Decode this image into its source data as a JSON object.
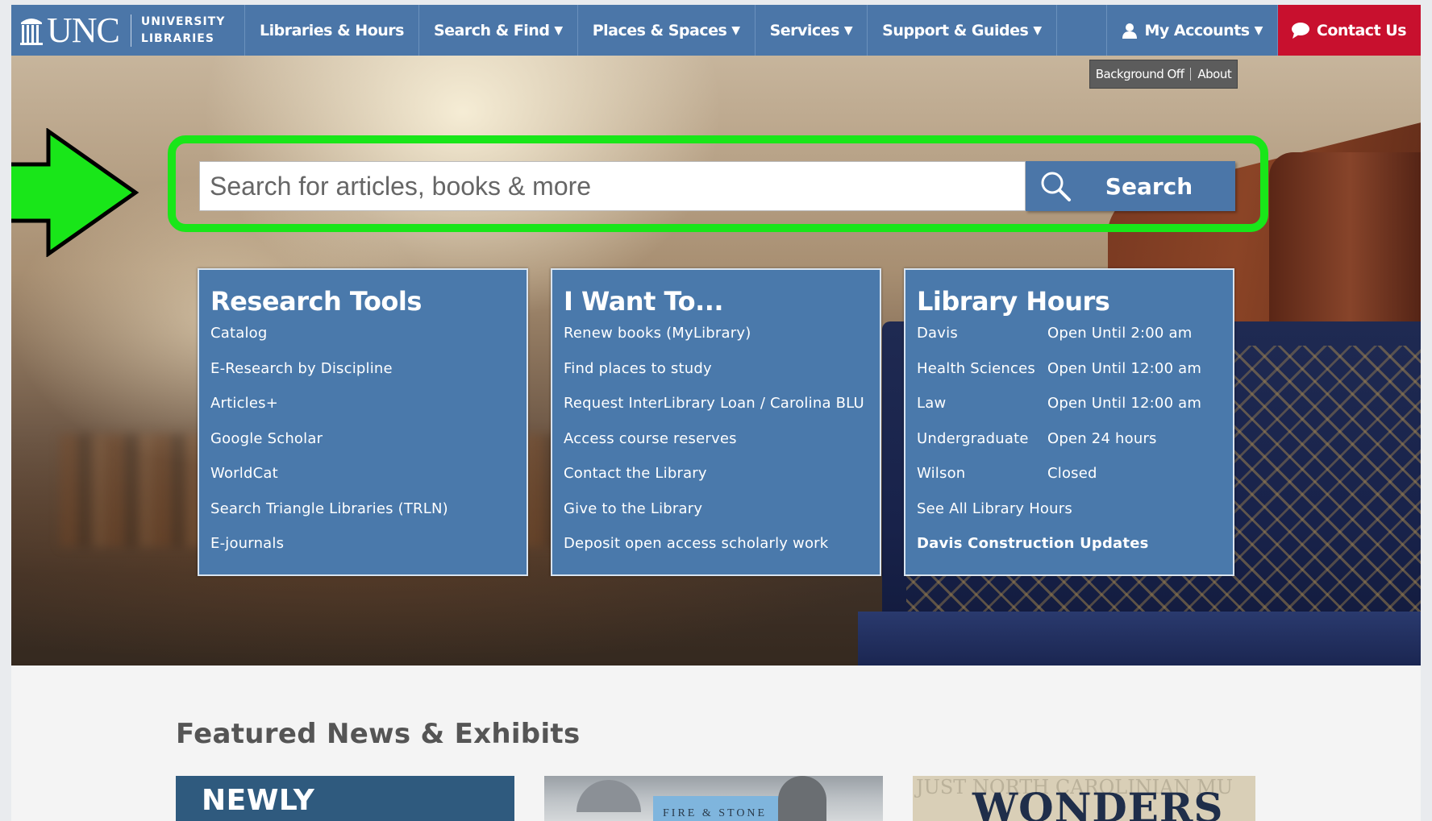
{
  "nav": {
    "logo_main": "UNC",
    "logo_line1": "UNIVERSITY",
    "logo_line2": "LIBRARIES",
    "items": [
      {
        "label": "Libraries & Hours",
        "caret": ""
      },
      {
        "label": "Search & Find",
        "caret": "▼"
      },
      {
        "label": "Places & Spaces",
        "caret": "▼"
      },
      {
        "label": "Services",
        "caret": "▼"
      },
      {
        "label": "Support & Guides",
        "caret": "▼"
      }
    ],
    "accounts": {
      "label": "My Accounts",
      "caret": "▼",
      "icon": "person-icon"
    },
    "contact": {
      "label": "Contact Us",
      "icon": "chat-bubble-icon"
    },
    "colors": {
      "nav_bg": "#4b76a8",
      "contact_bg": "#c8102e"
    }
  },
  "background_toggle": {
    "off_label": "Background Off",
    "about_label": "About"
  },
  "search": {
    "placeholder": "Search for articles, books & more",
    "button_label": "Search",
    "icon": "search-icon",
    "highlight_color": "#19e619"
  },
  "panels": {
    "research": {
      "title": "Research Tools",
      "links": [
        "Catalog",
        "E-Research by Discipline",
        "Articles+",
        "Google Scholar",
        "WorldCat",
        "Search Triangle Libraries (TRLN)",
        "E-journals"
      ]
    },
    "want": {
      "title": "I Want To...",
      "links": [
        "Renew books (MyLibrary)",
        "Find places to study",
        "Request InterLibrary Loan / Carolina BLU",
        "Access course reserves",
        "Contact the Library",
        "Give to the Library",
        "Deposit open access scholarly work"
      ]
    },
    "hours": {
      "title": "Library Hours",
      "rows": [
        {
          "loc": "Davis",
          "status": "Open Until 2:00 am"
        },
        {
          "loc": "Health Sciences",
          "status": "Open Until 12:00 am"
        },
        {
          "loc": "Law",
          "status": "Open Until 12:00 am"
        },
        {
          "loc": "Undergraduate",
          "status": "Open 24 hours"
        },
        {
          "loc": "Wilson",
          "status": "Closed"
        }
      ],
      "all_link": "See All Library Hours",
      "updates_link": "Davis Construction Updates"
    }
  },
  "featured": {
    "title": "Featured News & Exhibits",
    "card1": "NEWLY APPOINTED",
    "card2": "FIRE & STONE",
    "card3": "WONDERS",
    "card3_faint": "JUST NORTH CAROLINIAN MU"
  }
}
